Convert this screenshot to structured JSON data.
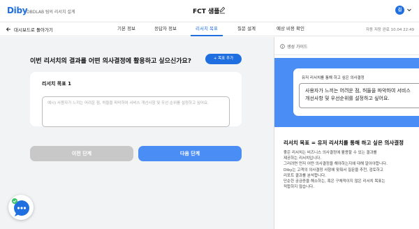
{
  "header": {
    "logo": "Diby",
    "subtitle": "DBDLAB 팀의 리서치 설계",
    "doc_title": "FCT 샘플",
    "avatar_initial": "김"
  },
  "nav": {
    "back_label": "대시보드로 돌아가기",
    "tabs": [
      {
        "label": "기본 정보",
        "active": false
      },
      {
        "label": "응답자 정보",
        "active": false
      },
      {
        "label": "리서치 목표",
        "active": true
      },
      {
        "label": "질문 설계",
        "active": false
      },
      {
        "label": "예상 비용 확인",
        "active": false
      }
    ],
    "autosave": "자동 저장 완료 10.04 22:49"
  },
  "main": {
    "question": "이번 리서치의 결과를 어떤 의사결정에 활용하고 싶으신가요?",
    "add_goal_label": "+ 목표 추가",
    "goal_card": {
      "title": "리서치 목표 1",
      "placeholder": "예시) 사용자가 느끼는 어려운 점, 허들을 파악하여 서비스 개선사항 및 우선 순위를 설정하고 싶어요."
    },
    "prev_label": "이전 단계",
    "next_label": "다음 단계"
  },
  "guide": {
    "label": "생성 가이드",
    "example_title": "유저 리서치를 통해 하고 싶은 의사결정",
    "example_text": "사용자가 느끼는 어려운 점, 허들을 파악하여 서비스 개선사항 및 우선순위를 설정하고 싶어요.",
    "heading": "리서치 목표 = 유저 리서치를 통해 하고 싶은 의사결정",
    "body_lines": [
      "좋은 리서치는 비즈니스 의사결정에 활용할 수 있는 결과를",
      "제공하는 리서치입니다.",
      "그러려면 먼저 어떤 의사결정을 해야하는지에 대해 알아야합니다.",
      "Diby는 고객의 의사결정 사항에 맞춰서 질문을 추천, 검토하고",
      "리포트 결과를 분석합니다.",
      "단순한 궁금증을 해소하는, 혹은 구체적이지 않은 리서치 목표는",
      "적합하지 않습니다."
    ]
  },
  "colors": {
    "accent": "#1f6fe0",
    "button_blue": "#4a8df5",
    "disabled": "#c8c8c8",
    "background": "#f2f3f5"
  }
}
